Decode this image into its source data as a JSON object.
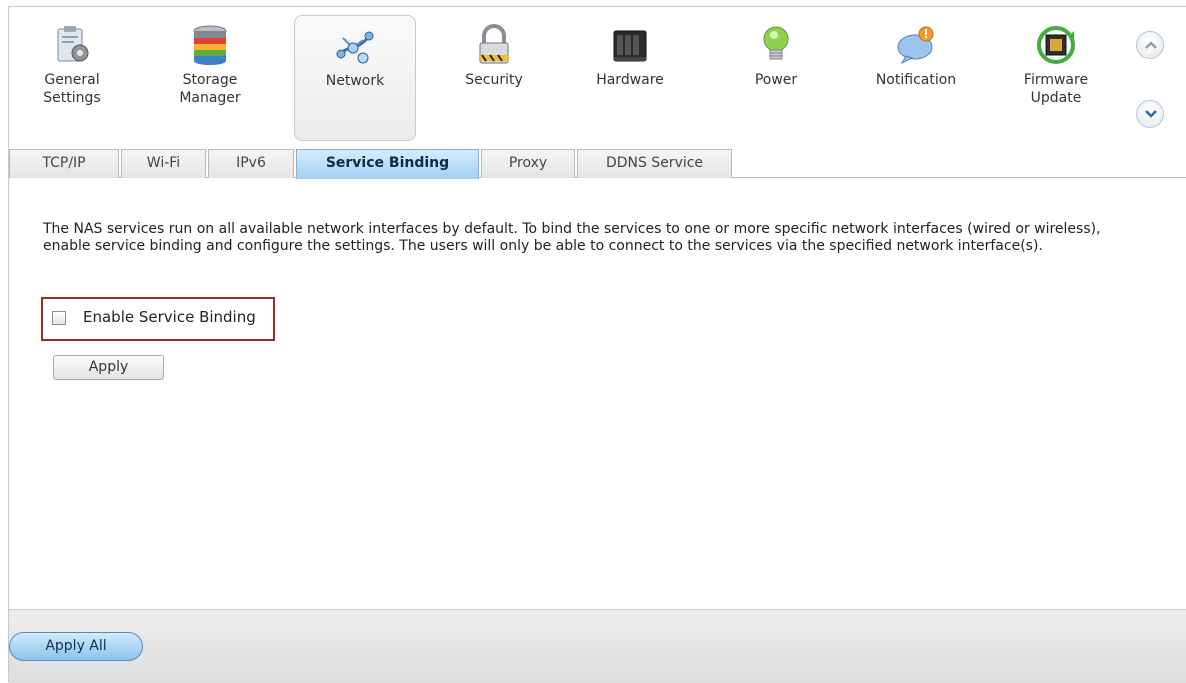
{
  "nav": {
    "items": [
      {
        "label": "General\nSettings",
        "icon": "general-settings-icon"
      },
      {
        "label": "Storage\nManager",
        "icon": "storage-manager-icon"
      },
      {
        "label": "Network",
        "icon": "network-icon"
      },
      {
        "label": "Security",
        "icon": "lock-icon"
      },
      {
        "label": "Hardware",
        "icon": "hardware-icon"
      },
      {
        "label": "Power",
        "icon": "lightbulb-icon"
      },
      {
        "label": "Notification",
        "icon": "notification-bubble-icon"
      },
      {
        "label": "Firmware\nUpdate",
        "icon": "firmware-chip-icon"
      }
    ],
    "active_index": 2
  },
  "tabs": [
    "TCP/IP",
    "Wi-Fi",
    "IPv6",
    "Service Binding",
    "Proxy",
    "DDNS Service"
  ],
  "active_tab": "Service Binding",
  "content": {
    "description": "The NAS services run on all available network interfaces by default. To bind the services to one or more specific network interfaces (wired or wireless), enable service binding and configure the settings. The users will only be able to connect to the services via the specified network interface(s).",
    "checkbox_label": "Enable Service Binding",
    "checkbox_checked": false,
    "apply_label": "Apply"
  },
  "footer": {
    "apply_all_label": "Apply All"
  },
  "colors": {
    "active_tab": "#9fd1f5",
    "highlight_border": "#9b2a2a",
    "apply_all": "#8cc3ec"
  }
}
